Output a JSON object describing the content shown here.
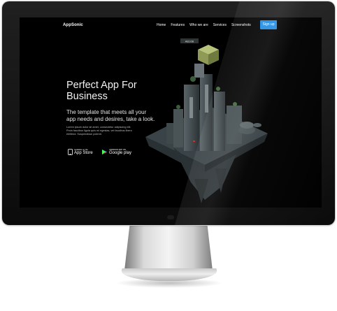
{
  "site": {
    "brand": "AppSonic",
    "nav": [
      "Home",
      "Features",
      "Who we are",
      "Services",
      "Screenshots"
    ],
    "signup_label": "Sign up"
  },
  "hero": {
    "title_line1": "Perfect App For",
    "title_line2": "Business",
    "subtitle_line1": "The template that meets all your",
    "subtitle_line2": "app needs and desires, take a look.",
    "body_line1": "Lorem ipsum dolor sit amet, consectetur adipiscing elit.",
    "body_line2": "Proin faucibus ligula quis mi egestas, vel faucibus libero",
    "body_line3": "eleifend. Suspendisse potenti."
  },
  "badges": {
    "apple_small": "Available on the",
    "apple_big": "App Store",
    "google_small": "ANDROID APP ON",
    "google_big": "Google play"
  },
  "artwork": {
    "sign_text": "AB10B"
  },
  "colors": {
    "accent": "#1f8ce4",
    "screen_bg": "#000000"
  },
  "icons": {
    "apple": "apple-icon",
    "google_play": "google-play-icon",
    "monitor_logo": "apple-logo-icon"
  }
}
